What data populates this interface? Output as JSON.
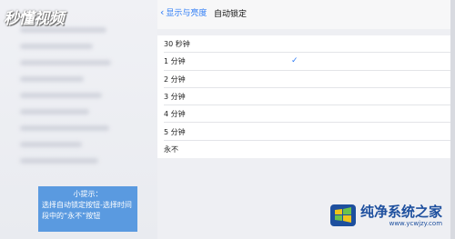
{
  "watermark": {
    "brand": "秒懂视频"
  },
  "tip": {
    "title": "小提示：",
    "text": "选择自动锁定按钮-选择时间段中的“永不”按钮"
  },
  "nav": {
    "back_label": "显示与亮度",
    "title": "自动锁定"
  },
  "options": [
    {
      "label": "30 秒钟",
      "selected": false
    },
    {
      "label": "1 分钟",
      "selected": true
    },
    {
      "label": "2 分钟",
      "selected": false
    },
    {
      "label": "3 分钟",
      "selected": false
    },
    {
      "label": "4 分钟",
      "selected": false
    },
    {
      "label": "5 分钟",
      "selected": false
    },
    {
      "label": "永不",
      "selected": false
    }
  ],
  "checkmark": "✓",
  "logo": {
    "name": "纯净系统之家",
    "url": "www.ycwjzy.com"
  },
  "colors": {
    "accent": "#2e7cf6",
    "tip_background": "#5a9ae0",
    "logo_blue": "#1d4f9e"
  }
}
